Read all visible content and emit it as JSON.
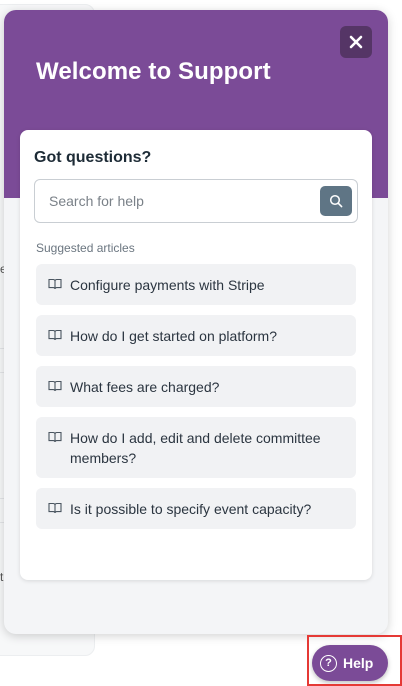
{
  "background": {
    "fragments": [
      "e",
      "t"
    ]
  },
  "header": {
    "title": "Welcome to Support",
    "close_icon": "close-icon"
  },
  "card": {
    "title": "Got questions?",
    "search": {
      "placeholder": "Search for help",
      "value": "",
      "button_icon": "search-icon"
    },
    "suggested_label": "Suggested articles",
    "articles": [
      {
        "icon": "book-icon",
        "label": "Configure payments with Stripe"
      },
      {
        "icon": "book-icon",
        "label": "How do I get started on platform?"
      },
      {
        "icon": "book-icon",
        "label": "What fees are charged?"
      },
      {
        "icon": "book-icon",
        "label": "How do I add, edit and delete committee members?"
      },
      {
        "icon": "book-icon",
        "label": "Is it possible to specify event capacity?"
      }
    ]
  },
  "launcher": {
    "label": "Help",
    "icon": "question-circle-icon",
    "glyph": "?"
  },
  "colors": {
    "brand": "#7b4b97",
    "close_bg": "#553566",
    "search_button": "#5f7585",
    "highlight": "#e53935"
  }
}
